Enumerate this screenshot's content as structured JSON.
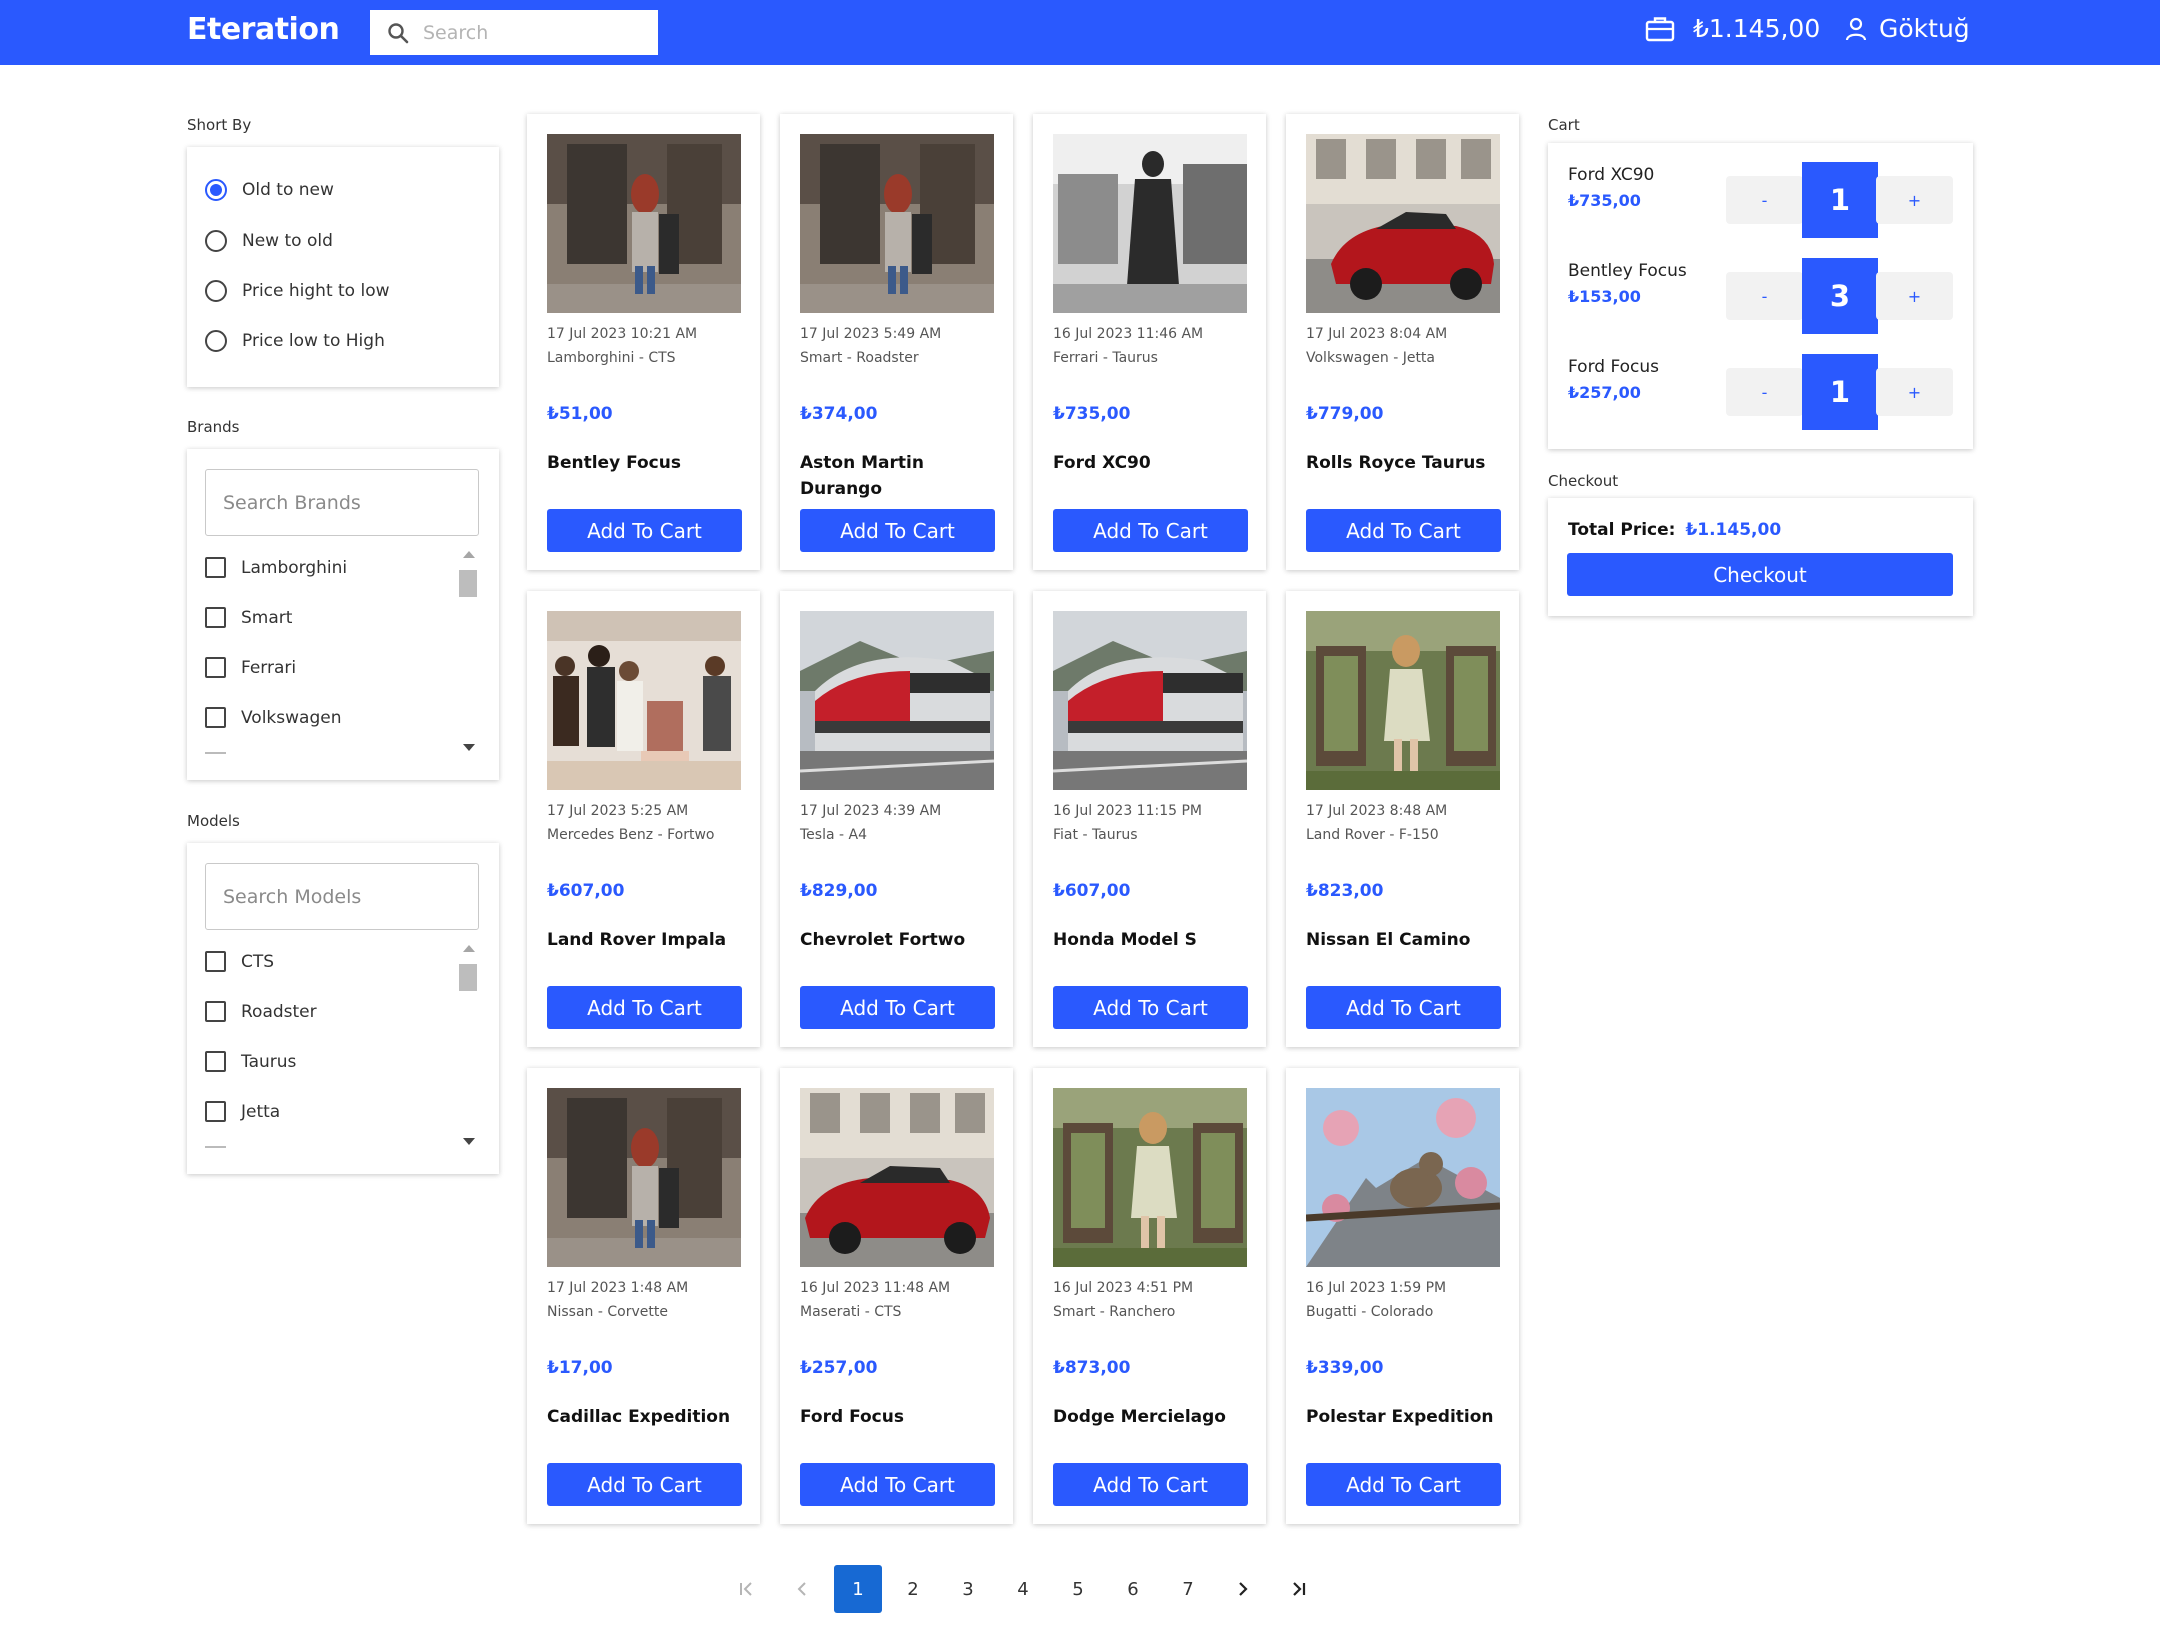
{
  "header": {
    "logo": "Eteration",
    "search_placeholder": "Search",
    "cart_total": "₺1.145,00",
    "user_name": "Göktuğ"
  },
  "sidebar": {
    "sort_label": "Short By",
    "sort_options": [
      "Old to new",
      "New to old",
      "Price hight to low",
      "Price low to High"
    ],
    "sort_selected_index": 0,
    "brands_label": "Brands",
    "brands_placeholder": "Search Brands",
    "brands": [
      "Lamborghini",
      "Smart",
      "Ferrari",
      "Volkswagen"
    ],
    "models_label": "Models",
    "models_placeholder": "Search Models",
    "models": [
      "CTS",
      "Roadster",
      "Taurus",
      "Jetta"
    ]
  },
  "products": [
    {
      "date": "17 Jul 2023 10:21 AM",
      "sub": "Lamborghini - CTS",
      "price": "₺51,00",
      "name": "Bentley Focus",
      "button": "Add To Cart"
    },
    {
      "date": "17 Jul 2023 5:49 AM",
      "sub": "Smart - Roadster",
      "price": "₺374,00",
      "name": "Aston Martin Durango",
      "button": "Add To Cart"
    },
    {
      "date": "16 Jul 2023 11:46 AM",
      "sub": "Ferrari - Taurus",
      "price": "₺735,00",
      "name": "Ford XC90",
      "button": "Add To Cart"
    },
    {
      "date": "17 Jul 2023 8:04 AM",
      "sub": "Volkswagen - Jetta",
      "price": "₺779,00",
      "name": "Rolls Royce Taurus",
      "button": "Add To Cart"
    },
    {
      "date": "17 Jul 2023 5:25 AM",
      "sub": "Mercedes Benz - Fortwo",
      "price": "₺607,00",
      "name": "Land Rover Impala",
      "button": "Add To Cart"
    },
    {
      "date": "17 Jul 2023 4:39 AM",
      "sub": "Tesla - A4",
      "price": "₺829,00",
      "name": "Chevrolet Fortwo",
      "button": "Add To Cart"
    },
    {
      "date": "16 Jul 2023 11:15 PM",
      "sub": "Fiat - Taurus",
      "price": "₺607,00",
      "name": "Honda Model S",
      "button": "Add To Cart"
    },
    {
      "date": "17 Jul 2023 8:48 AM",
      "sub": "Land Rover - F-150",
      "price": "₺823,00",
      "name": "Nissan El Camino",
      "button": "Add To Cart"
    },
    {
      "date": "17 Jul 2023 1:48 AM",
      "sub": "Nissan - Corvette",
      "price": "₺17,00",
      "name": "Cadillac Expedition",
      "button": "Add To Cart"
    },
    {
      "date": "16 Jul 2023 11:48 AM",
      "sub": "Maserati - CTS",
      "price": "₺257,00",
      "name": "Ford Focus",
      "button": "Add To Cart"
    },
    {
      "date": "16 Jul 2023 4:51 PM",
      "sub": "Smart - Ranchero",
      "price": "₺873,00",
      "name": "Dodge Mercielago",
      "button": "Add To Cart"
    },
    {
      "date": "16 Jul 2023 1:59 PM",
      "sub": "Bugatti - Colorado",
      "price": "₺339,00",
      "name": "Polestar Expedition",
      "button": "Add To Cart"
    }
  ],
  "cart": {
    "label": "Cart",
    "items": [
      {
        "name": "Ford XC90",
        "price": "₺735,00",
        "qty": "1"
      },
      {
        "name": "Bentley Focus",
        "price": "₺153,00",
        "qty": "3"
      },
      {
        "name": "Ford Focus",
        "price": "₺257,00",
        "qty": "1"
      }
    ],
    "minus": "-",
    "plus": "+"
  },
  "checkout": {
    "label": "Checkout",
    "total_label": "Total Price:",
    "total_value": "₺1.145,00",
    "button": "Checkout"
  },
  "pagination": {
    "pages": [
      "1",
      "2",
      "3",
      "4",
      "5",
      "6",
      "7"
    ],
    "current": "1"
  },
  "colors": {
    "primary": "#2a59fe",
    "page_active": "#1769d3"
  }
}
